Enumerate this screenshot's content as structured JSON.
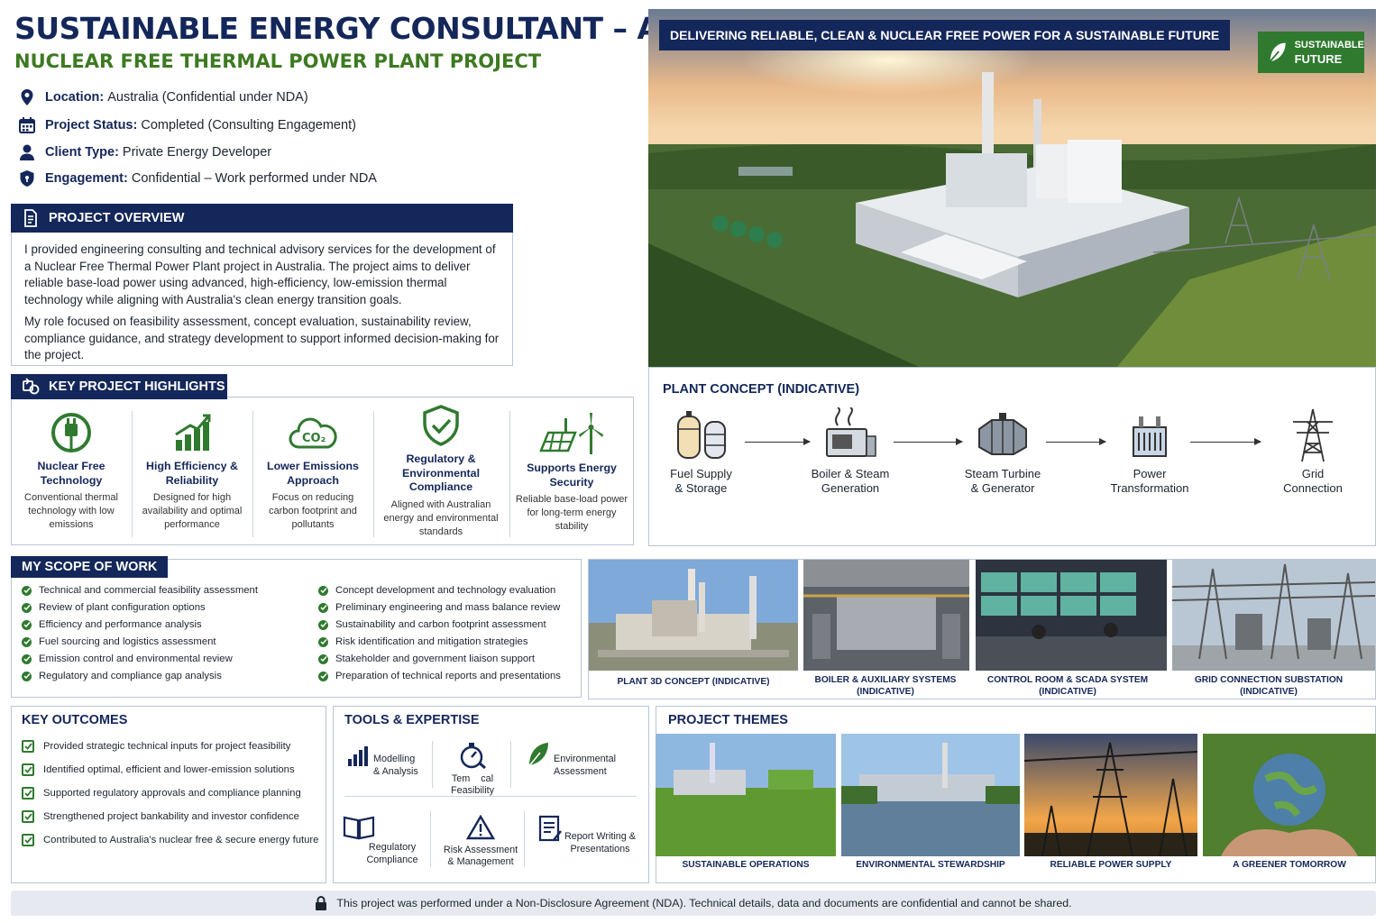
{
  "header": {
    "title": "SUSTAINABLE ENERGY CONSULTANT – AUSTRALIA",
    "subtitle": "NUCLEAR FREE THERMAL POWER PLANT PROJECT"
  },
  "info": [
    {
      "icon": "location-pin-icon",
      "label": "Location:",
      "value": "Australia (Confidential under NDA)"
    },
    {
      "icon": "calendar-icon",
      "label": "Project Status:",
      "value": "Completed (Consulting Engagement)"
    },
    {
      "icon": "person-icon",
      "label": "Client Type:",
      "value": "Private Energy Developer"
    },
    {
      "icon": "shield-icon",
      "label": "Engagement:",
      "value": "Confidential – Work performed under NDA"
    }
  ],
  "overview": {
    "heading": "PROJECT OVERVIEW",
    "p1": "I provided engineering consulting and technical advisory services for the development of a Nuclear Free Thermal Power Plant project in Australia. The project aims to deliver reliable base-load power using advanced, high-efficiency, low-emission thermal technology while aligning with Australia's clean energy transition goals.",
    "p2": "My role focused on feasibility assessment, concept evaluation, sustainability review, compliance guidance, and strategy development to support informed decision-making for the project."
  },
  "highlights": {
    "heading": "KEY PROJECT HIGHLIGHTS",
    "items": [
      {
        "title": "Nuclear Free Technology",
        "desc": "Conventional thermal technology with low emissions",
        "icon": "plug-leaf-icon"
      },
      {
        "title": "High Efficiency & Reliability",
        "desc": "Designed for high availability and optimal performance",
        "icon": "growth-chart-icon"
      },
      {
        "title": "Lower Emissions Approach",
        "desc": "Focus on reducing carbon footprint and pollutants",
        "icon": "co2-cloud-icon"
      },
      {
        "title": "Regulatory & Environmental Compliance",
        "desc": "Aligned with Australian energy and environmental standards",
        "icon": "shield-check-icon"
      },
      {
        "title": "Supports Energy Security",
        "desc": "Reliable base-load power for long-term energy stability",
        "icon": "solar-wind-icon"
      }
    ]
  },
  "hero": {
    "banner": "DELIVERING RELIABLE, CLEAN & NUCLEAR FREE POWER FOR A SUSTAINABLE FUTURE",
    "badge_line1": "SUSTAINABLE",
    "badge_line2": "FUTURE"
  },
  "plant_concept": {
    "heading": "PLANT CONCEPT (INDICATIVE)",
    "steps": [
      {
        "line1": "Fuel Supply",
        "line2": "& Storage",
        "icon": "fuel-tanks-icon"
      },
      {
        "line1": "Boiler & Steam",
        "line2": "Generation",
        "icon": "boiler-icon"
      },
      {
        "line1": "Steam Turbine",
        "line2": "& Generator",
        "icon": "turbine-icon"
      },
      {
        "line1": "Power",
        "line2": "Transformation",
        "icon": "transformer-icon"
      },
      {
        "line1": "Grid",
        "line2": "Connection",
        "icon": "pylon-icon"
      }
    ]
  },
  "scope": {
    "heading": "MY SCOPE OF WORK",
    "left": [
      "Technical and commercial feasibility assessment",
      "Review of plant configuration options",
      "Efficiency and performance analysis",
      "Fuel sourcing and logistics assessment",
      "Emission control and environmental review",
      "Regulatory and compliance gap analysis"
    ],
    "right": [
      "Concept development and technology evaluation",
      "Preliminary engineering and mass balance review",
      "Sustainability and carbon footprint assessment",
      "Risk identification and mitigation strategies",
      "Stakeholder and government liaison support",
      "Preparation of technical reports and presentations"
    ]
  },
  "gallery": [
    {
      "line1": "PLANT 3D CONCEPT (INDICATIVE)",
      "line2": ""
    },
    {
      "line1": "BOILER & AUXILIARY SYSTEMS",
      "line2": "(INDICATIVE)"
    },
    {
      "line1": "CONTROL ROOM & SCADA SYSTEM",
      "line2": "(INDICATIVE)"
    },
    {
      "line1": "GRID CONNECTION SUBSTATION",
      "line2": "(INDICATIVE)"
    }
  ],
  "outcomes": {
    "heading": "KEY OUTCOMES",
    "items": [
      "Provided strategic technical inputs for project feasibility",
      "Identified optimal, efficient and lower-emission solutions",
      "Supported regulatory approvals and compliance planning",
      "Strengthened project bankability and investor confidence",
      "Contributed to Australia's nuclear free & secure energy future"
    ]
  },
  "tools": {
    "heading": "TOOLS & EXPERTISE",
    "items": [
      {
        "line1": "Modelling",
        "line2": "& Analysis",
        "icon": "bar-chart-icon"
      },
      {
        "line1": "Tem    cal",
        "line2": "Feasibility",
        "icon": "stopwatch-icon"
      },
      {
        "line1": "Environmental",
        "line2": "Assessment",
        "icon": "leaf-icon"
      },
      {
        "line1": "Regulatory",
        "line2": "Compliance",
        "icon": "book-icon"
      },
      {
        "line1": "Risk Assessment",
        "line2": "& Management",
        "icon": "warning-icon"
      },
      {
        "line1": "Report Writing &",
        "line2": "Presentations",
        "icon": "report-icon"
      }
    ]
  },
  "themes": {
    "heading": "PROJECT THEMES",
    "items": [
      "SUSTAINABLE OPERATIONS",
      "ENVIRONMENTAL STEWARDSHIP",
      "RELIABLE POWER SUPPLY",
      "A GREENER TOMORROW"
    ]
  },
  "footer": {
    "note": "This project was performed under a Non-Disclosure Agreement (NDA). Technical details, data and documents are confidential and cannot be shared."
  }
}
